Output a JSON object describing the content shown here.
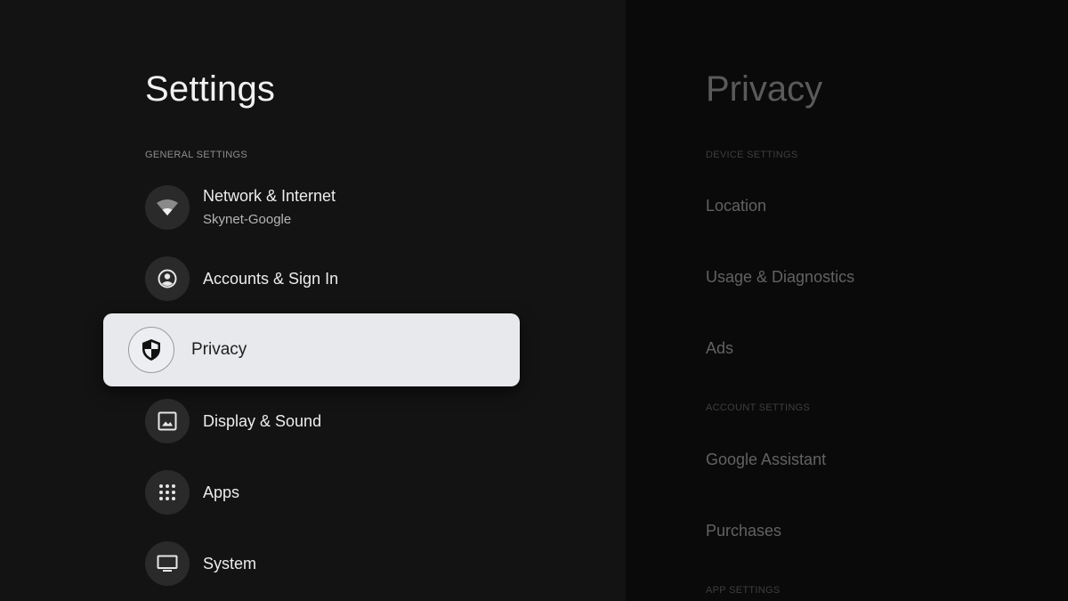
{
  "settings": {
    "title": "Settings",
    "section_label": "GENERAL SETTINGS",
    "items": [
      {
        "label": "Network & Internet",
        "sublabel": "Skynet-Google",
        "icon": "wifi-icon"
      },
      {
        "label": "Accounts & Sign In",
        "icon": "account-icon"
      },
      {
        "label": "Privacy",
        "icon": "shield-icon",
        "selected": true
      },
      {
        "label": "Display & Sound",
        "icon": "image-icon"
      },
      {
        "label": "Apps",
        "icon": "apps-grid-icon"
      },
      {
        "label": "System",
        "icon": "tv-icon"
      }
    ]
  },
  "privacy": {
    "title": "Privacy",
    "device_section_label": "DEVICE SETTINGS",
    "device_items": [
      "Location",
      "Usage & Diagnostics",
      "Ads"
    ],
    "account_section_label": "ACCOUNT SETTINGS",
    "account_items": [
      "Google Assistant",
      "Purchases"
    ],
    "app_section_label": "APP SETTINGS"
  },
  "colors": {
    "left_background": "#131313",
    "right_background": "#0a0a0a",
    "selected_background": "#e8e9ec",
    "icon_circle": "#2a2a2a"
  }
}
